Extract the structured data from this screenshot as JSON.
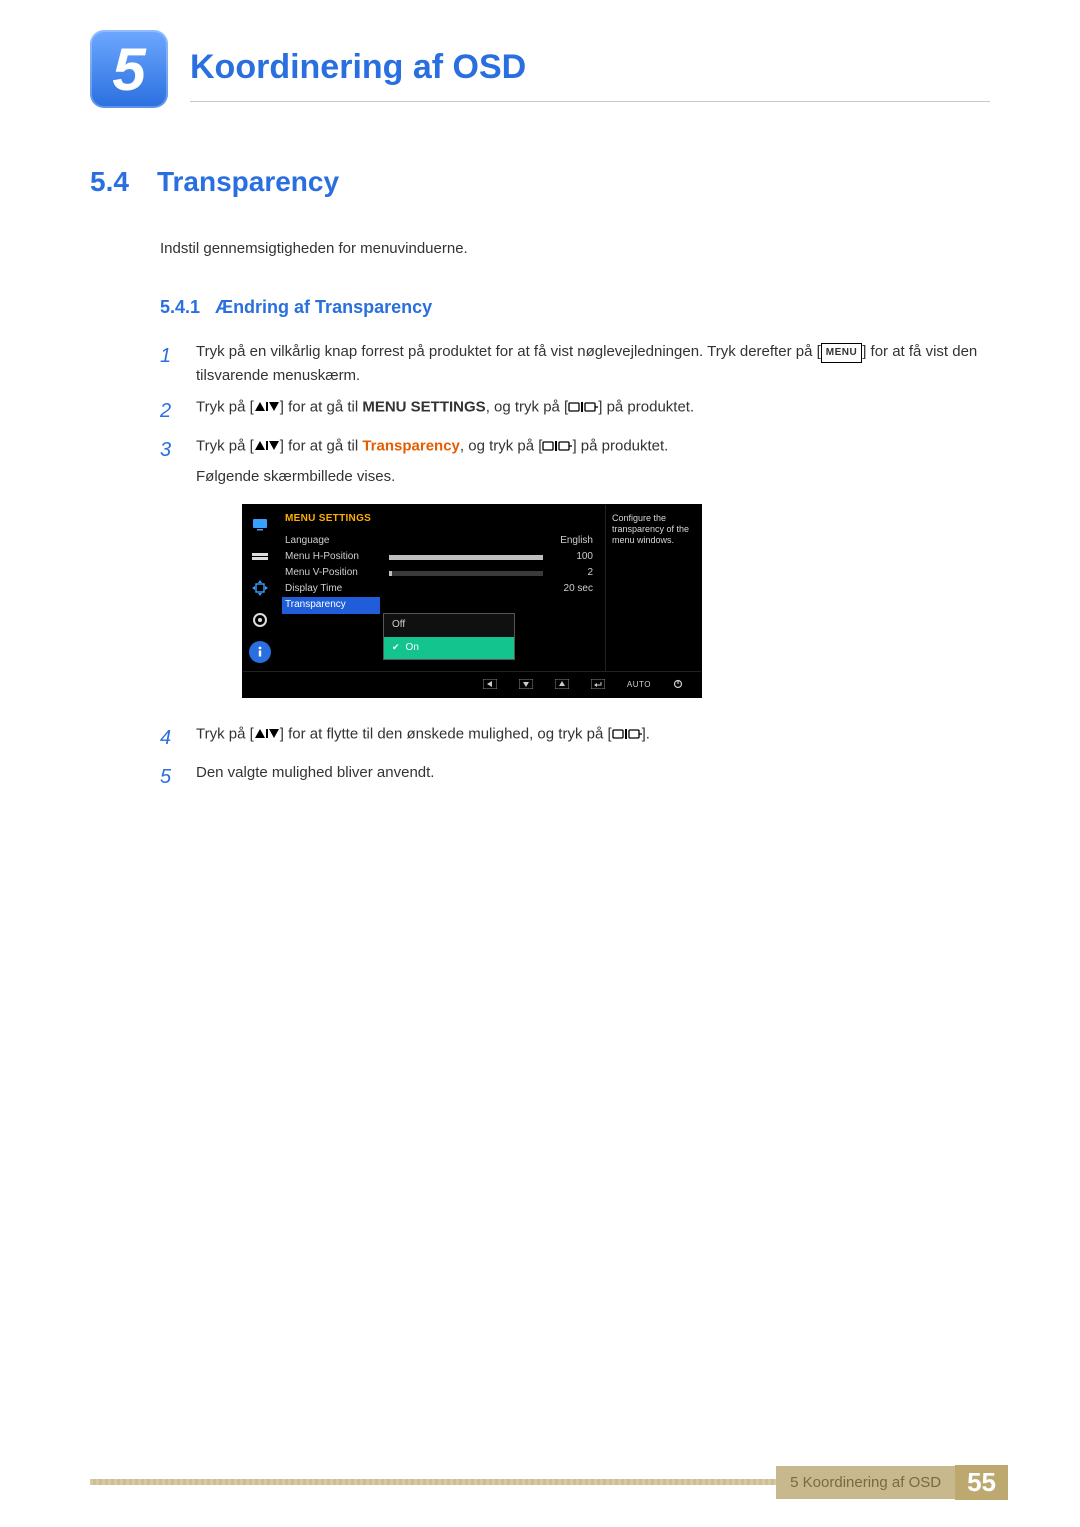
{
  "chapter": {
    "number": "5",
    "title": "Koordinering af OSD"
  },
  "section": {
    "number": "5.4",
    "title": "Transparency"
  },
  "intro": "Indstil gennemsigtigheden for menuvinduerne.",
  "subsection": {
    "number": "5.4.1",
    "title": "Ændring af Transparency"
  },
  "steps": {
    "s1_a": "Tryk på en vilkårlig knap forrest på produktet for at få vist nøglevejledningen. Tryk derefter på [",
    "s1_menu": "MENU",
    "s1_b": "] for at få vist den tilsvarende menuskærm.",
    "s2_a": "Tryk på [",
    "s2_b": "] for at gå til ",
    "s2_target": "MENU SETTINGS",
    "s2_c": ", og tryk på [",
    "s2_d": "] på produktet.",
    "s3_a": "Tryk på [",
    "s3_b": "] for at gå til ",
    "s3_target": "Transparency",
    "s3_c": ", og tryk på [",
    "s3_d": "] på produktet.",
    "s3_e": "Følgende skærmbillede vises.",
    "s4_a": "Tryk på [",
    "s4_b": "] for at flytte til den ønskede mulighed, og tryk på [",
    "s4_c": "].",
    "s5": "Den valgte mulighed bliver anvendt."
  },
  "osd": {
    "title": "MENU SETTINGS",
    "rows": {
      "language": {
        "label": "Language",
        "value": "English"
      },
      "hpos": {
        "label": "Menu H-Position",
        "value": "100",
        "fill": 100
      },
      "vpos": {
        "label": "Menu V-Position",
        "value": "2",
        "fill": 2
      },
      "dtime": {
        "label": "Display Time",
        "value": "20 sec"
      },
      "trans": {
        "label": "Transparency"
      }
    },
    "dropdown": {
      "off": "Off",
      "on": "On"
    },
    "help": "Configure the transparency of the menu windows.",
    "footer_auto": "AUTO"
  },
  "footer": {
    "text": "5 Koordinering af OSD",
    "page": "55"
  }
}
